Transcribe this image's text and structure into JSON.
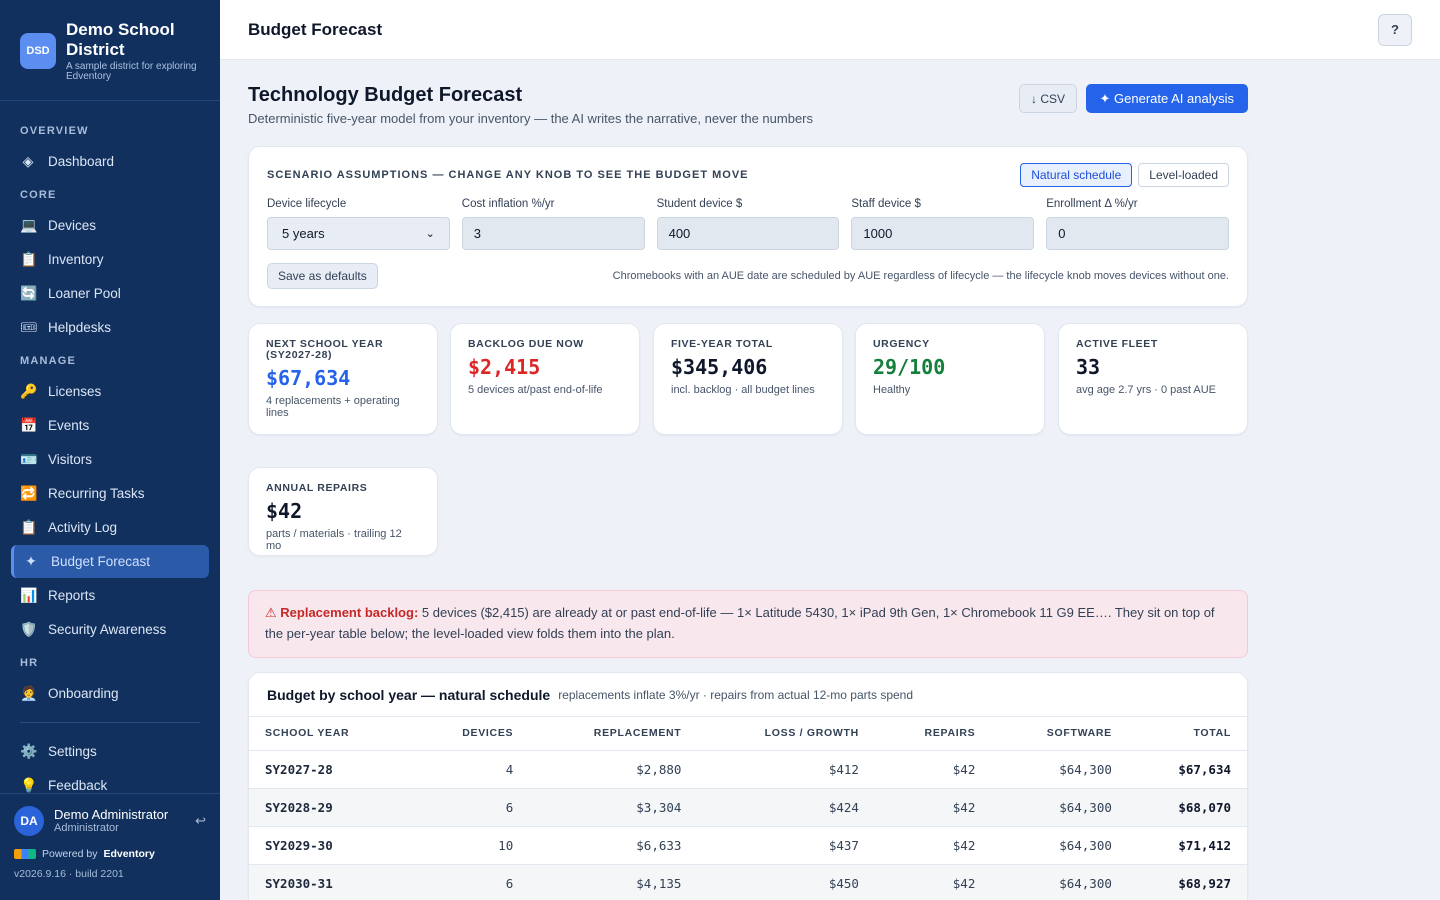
{
  "brand": {
    "logo": "DSD",
    "name": "Demo School District",
    "subtitle": "A sample district for exploring Edventory"
  },
  "sidebar": {
    "sections": {
      "overview": "OVERVIEW",
      "core": "CORE",
      "manage": "MANAGE",
      "hr": "HR"
    },
    "items": {
      "dashboard": {
        "label": "Dashboard",
        "icon": "◈"
      },
      "devices": {
        "label": "Devices",
        "icon": "💻"
      },
      "inventory": {
        "label": "Inventory",
        "icon": "📋"
      },
      "loaner_pool": {
        "label": "Loaner Pool",
        "icon": "🔄"
      },
      "helpdesks": {
        "label": "Helpdesks",
        "icon": "🎟"
      },
      "licenses": {
        "label": "Licenses",
        "icon": "🔑"
      },
      "events": {
        "label": "Events",
        "icon": "📅"
      },
      "visitors": {
        "label": "Visitors",
        "icon": "🪪"
      },
      "recurring_tasks": {
        "label": "Recurring Tasks",
        "icon": "🔁"
      },
      "activity_log": {
        "label": "Activity Log",
        "icon": "📋"
      },
      "budget_forecast": {
        "label": "Budget Forecast",
        "icon": "✦"
      },
      "reports": {
        "label": "Reports",
        "icon": "📊"
      },
      "security_awareness": {
        "label": "Security Awareness",
        "icon": "🛡️"
      },
      "onboarding": {
        "label": "Onboarding",
        "icon": "🧑‍💼"
      },
      "settings": {
        "label": "Settings",
        "icon": "⚙️"
      },
      "feedback": {
        "label": "Feedback",
        "icon": "💡"
      }
    },
    "user": {
      "initials": "DA",
      "name": "Demo Administrator",
      "role": "Administrator",
      "logout_icon": "↩"
    },
    "powered_prefix": "Powered by",
    "powered_brand": "Edventory",
    "version": "v2026.9.16 · build 2201"
  },
  "topbar": {
    "title": "Budget Forecast",
    "help": "?"
  },
  "page": {
    "title": "Technology Budget Forecast",
    "subtitle": "Deterministic five-year model from your inventory — the AI writes the narrative, never the numbers",
    "csv_label": "↓ CSV",
    "ai_label": "✦ Generate AI analysis"
  },
  "scenario": {
    "title": "SCENARIO ASSUMPTIONS — CHANGE ANY KNOB TO SEE THE BUDGET MOVE",
    "toggle": {
      "natural": "Natural schedule",
      "level": "Level-loaded"
    },
    "fields": {
      "lifecycle": {
        "label": "Device lifecycle",
        "value": "5 years"
      },
      "inflation": {
        "label": "Cost inflation %/yr",
        "value": "3"
      },
      "student": {
        "label": "Student device $",
        "value": "400"
      },
      "staff": {
        "label": "Staff device $",
        "value": "1000"
      },
      "enrollment": {
        "label": "Enrollment Δ %/yr",
        "value": "0"
      }
    },
    "save_label": "Save as defaults",
    "note": "Chromebooks with an AUE date are scheduled by AUE regardless of lifecycle — the lifecycle knob moves devices without one."
  },
  "stats": {
    "next_year": {
      "label": "NEXT SCHOOL YEAR (SY2027-28)",
      "value": "$67,634",
      "sub": "4 replacements + operating lines",
      "color": "#2563eb"
    },
    "backlog": {
      "label": "BACKLOG DUE NOW",
      "value": "$2,415",
      "sub": "5 devices at/past end-of-life",
      "color": "#dc2626"
    },
    "five_year": {
      "label": "FIVE-YEAR TOTAL",
      "value": "$345,406",
      "sub": "incl. backlog · all budget lines",
      "color": "#0f172a"
    },
    "urgency": {
      "label": "URGENCY",
      "value": "29/100",
      "sub": "Healthy",
      "color": "#15803d"
    },
    "fleet": {
      "label": "ACTIVE FLEET",
      "value": "33",
      "sub": "avg age 2.7 yrs · 0 past AUE",
      "color": "#0f172a"
    },
    "repairs": {
      "label": "ANNUAL REPAIRS",
      "value": "$42",
      "sub": "parts / materials · trailing 12 mo",
      "color": "#0f172a"
    }
  },
  "alert": {
    "icon": "⚠",
    "heading": "Replacement backlog:",
    "text": "5 devices ($2,415) are already at or past end-of-life — 1× Latitude 5430, 1× iPad 9th Gen, 1× Chromebook 11 G9 EE…. They sit on top of the per-year table below; the level-loaded view folds them into the plan."
  },
  "table": {
    "title": "Budget by school year — natural schedule",
    "subtitle": "replacements inflate 3%/yr · repairs from actual 12-mo parts spend",
    "columns": [
      "SCHOOL YEAR",
      "DEVICES",
      "REPLACEMENT",
      "LOSS / GROWTH",
      "REPAIRS",
      "SOFTWARE",
      "TOTAL"
    ],
    "rows": [
      [
        "SY2027-28",
        "4",
        "$2,880",
        "$412",
        "$42",
        "$64,300",
        "$67,634"
      ],
      [
        "SY2028-29",
        "6",
        "$3,304",
        "$424",
        "$42",
        "$64,300",
        "$68,070"
      ],
      [
        "SY2029-30",
        "10",
        "$6,633",
        "$437",
        "$42",
        "$64,300",
        "$71,412"
      ],
      [
        "SY2030-31",
        "6",
        "$4,135",
        "$450",
        "$42",
        "$64,300",
        "$68,927"
      ]
    ]
  }
}
